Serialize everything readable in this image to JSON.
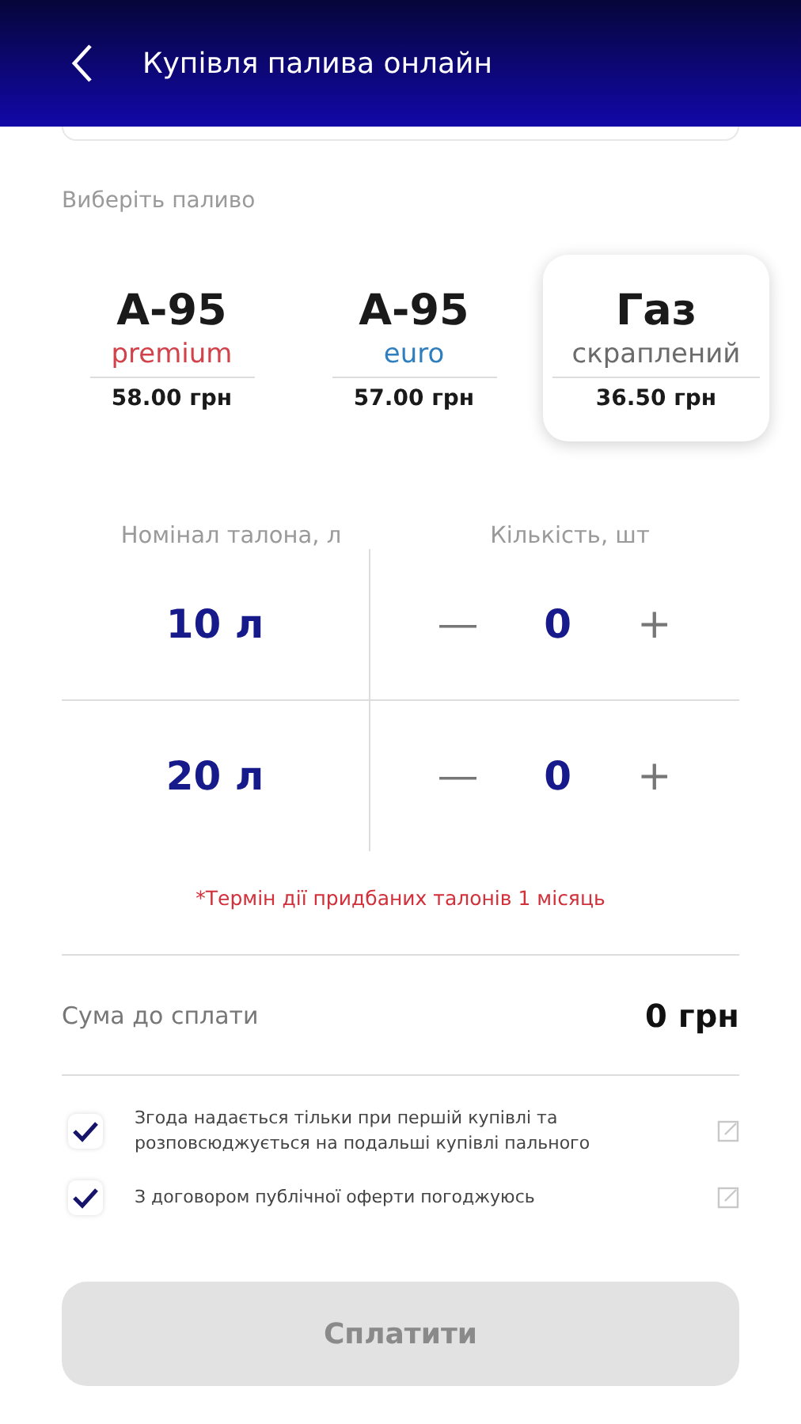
{
  "header": {
    "title": "Купівля палива онлайн"
  },
  "fuel_section": {
    "label": "Виберіть паливо"
  },
  "fuels": [
    {
      "name": "А-95",
      "grade": "premium",
      "color": "#d2424a",
      "price": "58.00 грн",
      "selected": false
    },
    {
      "name": "А-95",
      "grade": "euro",
      "color": "#2f7fbf",
      "price": "57.00 грн",
      "selected": false
    },
    {
      "name": "Газ",
      "grade": "скраплений",
      "color": "#6b6b6b",
      "price": "36.50 грн",
      "selected": true
    }
  ],
  "table": {
    "columns": [
      "Номінал талона, л",
      "Кількість, шт"
    ],
    "rows": [
      {
        "nominal": "10 л",
        "minus": "—",
        "quantity": "0",
        "plus": "+"
      },
      {
        "nominal": "20 л",
        "minus": "—",
        "quantity": "0",
        "plus": "+"
      }
    ]
  },
  "note": "*Термін дії придбаних талонів 1 місяць",
  "total": {
    "label": "Сума до сплати",
    "value": "0 грн"
  },
  "agreements": [
    {
      "text": "Згода надається тільки при першій купівлі та розповсюджується на подальші купівлі пального",
      "checked": true
    },
    {
      "text": "З договором публічної оферти погоджуюсь",
      "checked": true
    }
  ],
  "pay_button": {
    "label": "Сплатити",
    "disabled": true
  }
}
